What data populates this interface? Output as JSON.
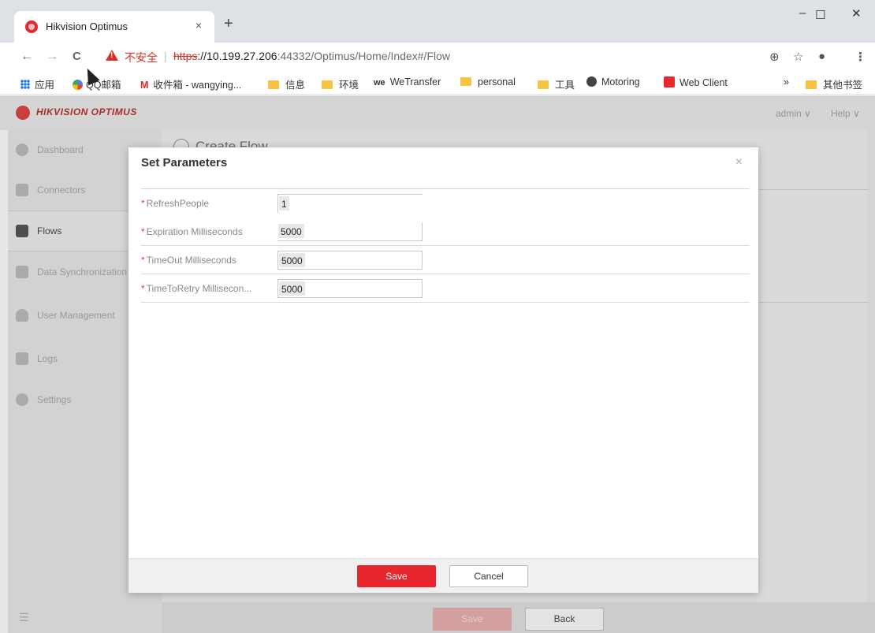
{
  "browser": {
    "tab_title": "Hikvision Optimus",
    "tab_close": "×",
    "new_tab": "+",
    "window_controls": {
      "minimize": "–",
      "maximize": "☐",
      "close": "✕"
    },
    "nav": {
      "back": "←",
      "forward": "→",
      "reload": "C"
    },
    "security_label": "不安全",
    "url_scheme": "https",
    "url_host": "://10.199.27.206",
    "url_rest": ":44332/Optimus/Home/Index#/Flow",
    "zoom_icon": "search-zoom-icon",
    "bookmarks": [
      {
        "label": "应用",
        "icon": "apps-grid-icon"
      },
      {
        "label": "QQ邮箱",
        "icon": "qq-mail-icon"
      },
      {
        "label": "收件箱 - wangying...",
        "icon": "gmail-icon"
      },
      {
        "label": "信息",
        "icon": "folder-icon"
      },
      {
        "label": "环境",
        "icon": "folder-icon"
      },
      {
        "label": "WeTransfer",
        "icon": "wetransfer-icon"
      },
      {
        "label": "personal",
        "icon": "folder-icon"
      },
      {
        "label": "工具",
        "icon": "folder-icon"
      },
      {
        "label": "Motoring",
        "icon": "globe-icon"
      },
      {
        "label": "Web Client",
        "icon": "webclient-icon"
      }
    ],
    "bookmarks_overflow": "»",
    "other_bookmarks": "其他书签"
  },
  "app": {
    "logo_text": "HIKVISION OPTIMUS",
    "user_menu": "admin ∨",
    "help_menu": "Help ∨",
    "sidebar": [
      {
        "label": "Dashboard",
        "icon": "dashboard-icon"
      },
      {
        "label": "Connectors",
        "icon": "connectors-icon"
      },
      {
        "label": "Flows",
        "icon": "flows-icon",
        "active": true
      },
      {
        "label": "Data Synchronization",
        "icon": "data-sync-icon"
      },
      {
        "label": "User Management",
        "icon": "user-icon"
      },
      {
        "label": "Logs",
        "icon": "logs-icon"
      },
      {
        "label": "Settings",
        "icon": "gear-icon"
      }
    ],
    "sidebar_footer": "☰",
    "page_title": "Create Flow",
    "footer_save": "Save",
    "footer_back": "Back"
  },
  "modal": {
    "title": "Set Parameters",
    "close": "×",
    "params": [
      {
        "label": "RefreshPeople",
        "value": "1"
      },
      {
        "label": "Expiration Milliseconds",
        "value": "5000"
      },
      {
        "label": "TimeOut Milliseconds",
        "value": "5000"
      },
      {
        "label": "TimeToRetry Millisecon...",
        "value": "5000"
      }
    ],
    "required_mark": "*",
    "save_label": "Save",
    "cancel_label": "Cancel"
  },
  "colors": {
    "accent": "#e8262d",
    "insecure": "#d93025",
    "bookmark_folder": "#f6c342"
  }
}
